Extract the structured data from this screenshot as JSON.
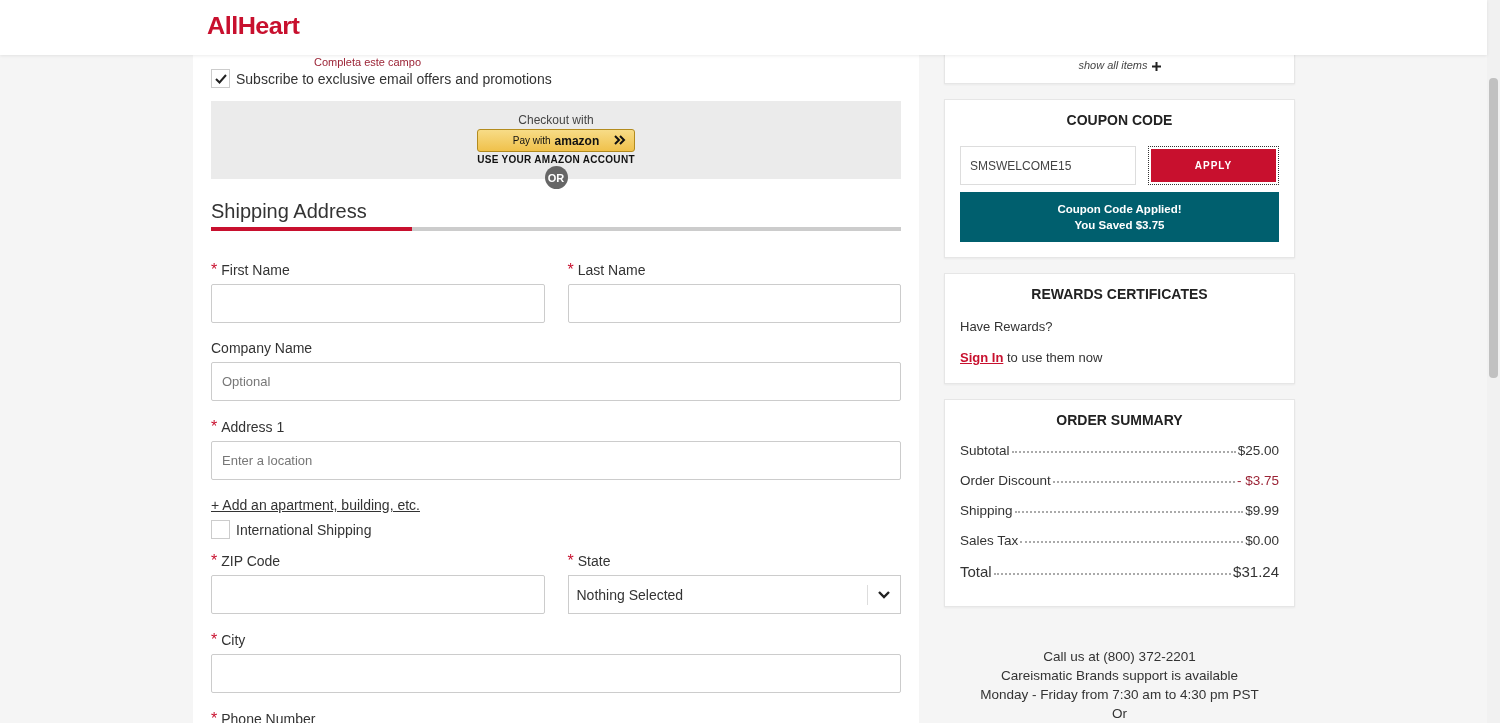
{
  "header": {
    "logo": "AllHeart"
  },
  "form": {
    "error": "Completa este campo",
    "subscribe": {
      "label": "Subscribe to exclusive email offers and promotions",
      "checked": true
    },
    "amazon": {
      "caption": "Checkout with",
      "button_prefix": "Pay with",
      "button_brand": "amazon",
      "account": "USE YOUR AMAZON ACCOUNT",
      "or": "OR"
    },
    "section_title": "Shipping Address",
    "required_mark": "*",
    "rows": [
      [
        {
          "kind": "text",
          "label": "First Name",
          "required": true
        },
        {
          "kind": "text",
          "label": "Last Name",
          "required": true
        }
      ],
      [
        {
          "kind": "text",
          "label": "Company Name",
          "required": false,
          "placeholder": "Optional"
        }
      ],
      [
        {
          "kind": "text",
          "label": "Address 1",
          "required": true,
          "placeholder": "Enter a location"
        }
      ],
      [
        {
          "kind": "link",
          "label": "+ Add an apartment, building, etc."
        }
      ],
      [
        {
          "kind": "checkbox",
          "label": "International Shipping",
          "checked": false
        }
      ],
      [
        {
          "kind": "text",
          "label": "ZIP Code",
          "required": true
        },
        {
          "kind": "select",
          "label": "State",
          "required": true,
          "value": "Nothing Selected"
        }
      ],
      [
        {
          "kind": "text",
          "label": "City",
          "required": true
        }
      ],
      [
        {
          "kind": "label",
          "label": "Phone Number",
          "required": true
        }
      ]
    ]
  },
  "cart": {
    "show_all": "show all items"
  },
  "coupon": {
    "title": "COUPON CODE",
    "value": "SMSWELCOME15",
    "button": "APPLY",
    "message": [
      "Coupon Code Applied!",
      "You Saved $3.75"
    ]
  },
  "rewards": {
    "title": "REWARDS CERTIFICATES",
    "question": "Have Rewards?",
    "link": "Sign In",
    "rest": "to use them now"
  },
  "summary": {
    "title": "ORDER SUMMARY",
    "lines": [
      {
        "label": "Subtotal",
        "value": "$25.00",
        "kind": "normal"
      },
      {
        "label": "Order Discount",
        "value": "- $3.75",
        "kind": "discount"
      },
      {
        "label": "Shipping",
        "value": "$9.99",
        "kind": "normal"
      },
      {
        "label": "Sales Tax",
        "value": "$0.00",
        "kind": "normal"
      },
      {
        "label": "Total",
        "value": "$31.24",
        "kind": "total"
      }
    ]
  },
  "support": [
    "Call us at (800) 372-2201",
    "Careismatic Brands support is available",
    "Monday - Friday from 7:30 am to 4:30 pm PST",
    "Or"
  ]
}
